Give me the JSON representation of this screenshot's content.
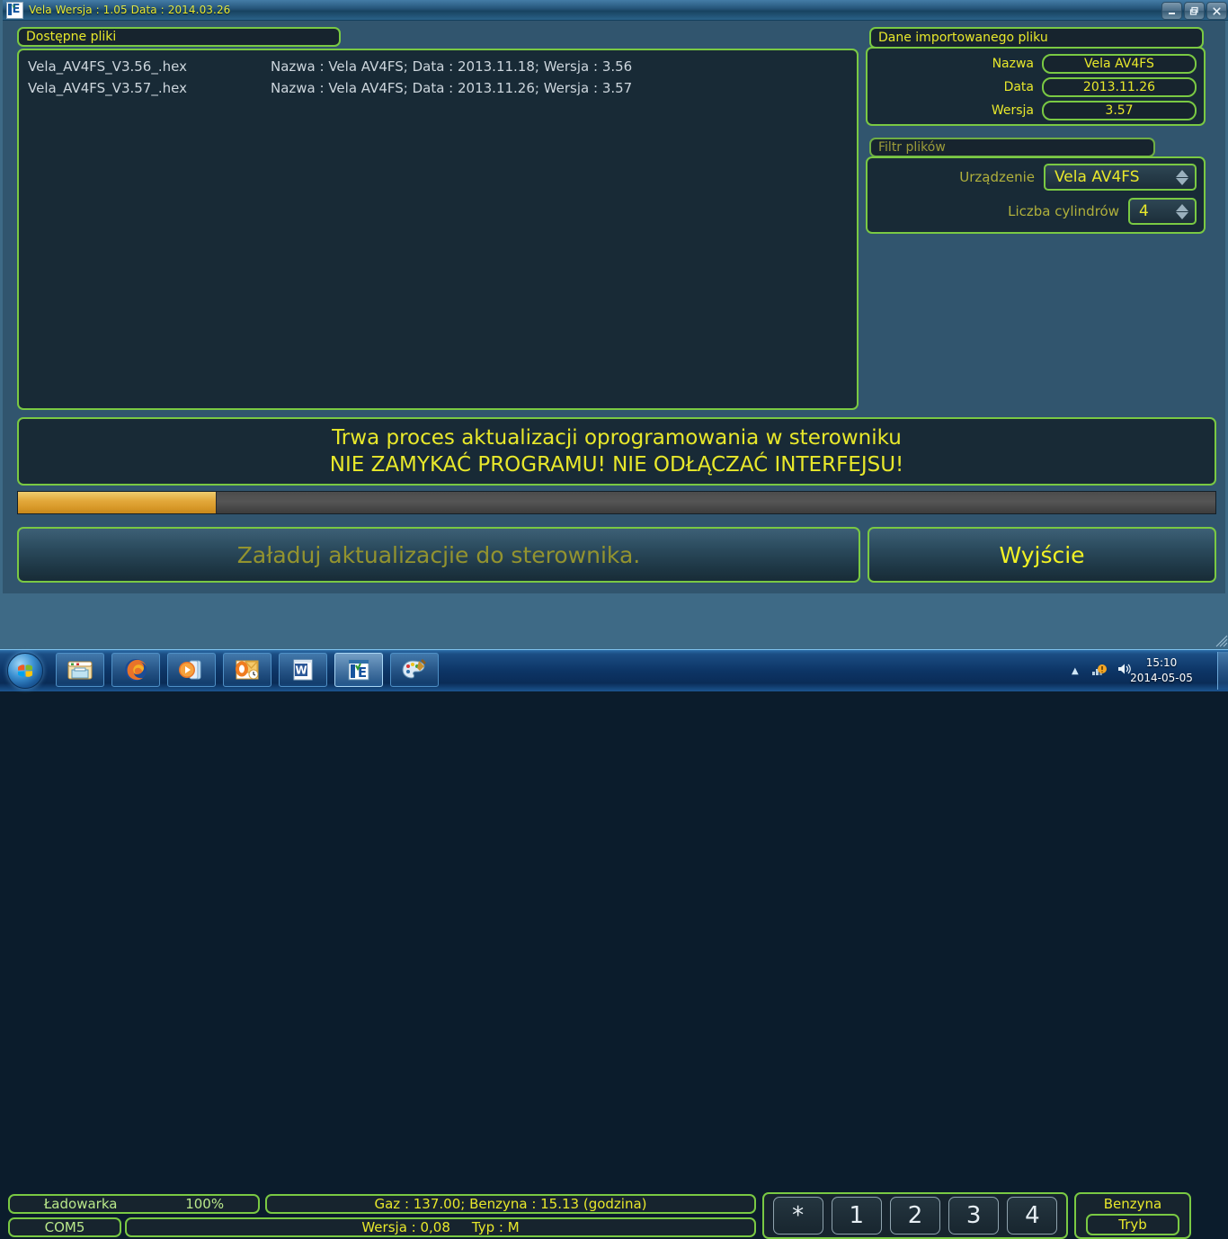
{
  "window": {
    "title": "Vela  Wersja : 1.05  Data : 2014.03.26",
    "app_icon": "vela-e-icon",
    "minimize_label": "–",
    "restore_label": "❐",
    "close_label": "✕"
  },
  "files_panel": {
    "header": "Dostępne pliki",
    "rows": [
      {
        "filename": "Vela_AV4FS_V3.56_.hex",
        "meta": "Nazwa : Vela AV4FS;  Data : 2013.11.18;  Wersja : 3.56"
      },
      {
        "filename": "Vela_AV4FS_V3.57_.hex",
        "meta": "Nazwa : Vela AV4FS;  Data : 2013.11.26;  Wersja : 3.57"
      }
    ]
  },
  "imported": {
    "header": "Dane importowanego pliku",
    "fields": [
      {
        "label": "Nazwa",
        "value": "Vela AV4FS"
      },
      {
        "label": "Data",
        "value": "2013.11.26"
      },
      {
        "label": "Wersja",
        "value": "3.57"
      }
    ]
  },
  "filter": {
    "header": "Filtr plików",
    "device_label": "Urządzenie",
    "device_value": "Vela AV4FS",
    "cylinders_label": "Liczba cylindrów",
    "cylinders_value": "4"
  },
  "warning": {
    "line1": "Trwa proces aktualizacji oprogramowania w sterowniku",
    "line2": "NIE ZAMYKAĆ PROGRAMU! NIE ODŁĄCZAĆ INTERFEJSU!"
  },
  "progress": {
    "percent": 16.5
  },
  "actions": {
    "load_label": "Załaduj aktualizacjie do sterownika.",
    "exit_label": "Wyjście"
  },
  "statusbar": {
    "charger_label": "Ładowarka",
    "charger_value": "100%",
    "com_port": "COM5",
    "fuel_text": "Gaz : 137.00; Benzyna : 15.13 (godzina)",
    "version_text": "Wersja : 0,08",
    "type_text": "Typ : M",
    "cylinder_buttons": [
      "*",
      "1",
      "2",
      "3",
      "4"
    ],
    "mode_title": "Benzyna",
    "mode_button": "Tryb"
  },
  "taskbar": {
    "start_label": "start-orb",
    "items": [
      {
        "name": "explorer-icon",
        "active": false
      },
      {
        "name": "firefox-icon",
        "active": false
      },
      {
        "name": "media-player-icon",
        "active": false
      },
      {
        "name": "outlook-icon",
        "active": false
      },
      {
        "name": "word-icon",
        "active": false
      },
      {
        "name": "vela-app-icon",
        "active": true
      },
      {
        "name": "paint-icon",
        "active": false
      }
    ],
    "tray": {
      "chevron": "▲",
      "network_icon": "network-icon",
      "volume_icon": "volume-icon",
      "time": "15:10",
      "date": "2014-05-05"
    }
  },
  "colors": {
    "accent_green": "#7ac943",
    "accent_yellow": "#e8e82b",
    "panel_bg": "#182a36",
    "window_bg": "#31556e",
    "progress_fill": "#e3a93c"
  }
}
